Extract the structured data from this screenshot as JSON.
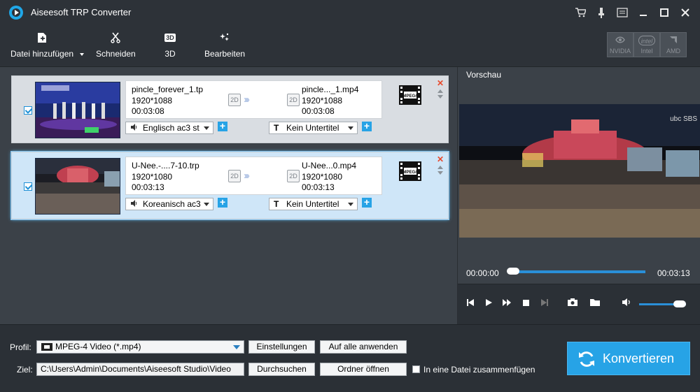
{
  "app": {
    "title": "Aiseesoft TRP Converter"
  },
  "toolbar": {
    "add_file": "Datei hinzufügen",
    "cut": "Schneiden",
    "three_d": "3D",
    "edit": "Bearbeiten",
    "hw_nvidia": "NVIDIA",
    "hw_intel": "Intel",
    "hw_amd": "AMD",
    "hw_intel_logo": "intel",
    "three_d_icon_text": "3D"
  },
  "files": [
    {
      "src_name": "pincle_forever_1.tp",
      "src_res": "1920*1088",
      "src_dur": "00:03:08",
      "dst_name": "pincle..._1.mp4",
      "dst_res": "1920*1088",
      "dst_dur": "00:03:08",
      "badge_src": "2D",
      "badge_dst": "2D",
      "audio": "Englisch ac3 st",
      "subtitle": "Kein Untertitel",
      "format_icon_label": "MPEG4"
    },
    {
      "src_name": "U-Nee.-....7-10.trp",
      "src_res": "1920*1080",
      "src_dur": "00:03:13",
      "dst_name": "U-Nee...0.mp4",
      "dst_res": "1920*1080",
      "dst_dur": "00:03:13",
      "badge_src": "2D",
      "badge_dst": "2D",
      "audio": "Koreanisch ac3",
      "subtitle": "Kein Untertitel",
      "format_icon_label": "MPEG4"
    }
  ],
  "preview": {
    "title": "Vorschau",
    "current_time": "00:00:00",
    "total_time": "00:03:13",
    "progress": 0,
    "volume": 0.8,
    "watermark": "ubc SBS"
  },
  "bottom": {
    "profile_label": "Profil:",
    "profile_value": "MPEG-4 Video (*.mp4)",
    "settings_btn": "Einstellungen",
    "apply_all_btn": "Auf alle anwenden",
    "dest_label": "Ziel:",
    "dest_value": "C:\\Users\\Admin\\Documents\\Aiseesoft Studio\\Video",
    "browse_btn": "Durchsuchen",
    "open_folder_btn": "Ordner öffnen",
    "merge_label": "In eine Datei zusammenfügen",
    "convert_btn": "Konvertieren"
  },
  "colors": {
    "accent": "#27a3e6",
    "bg_dark": "#2b3036",
    "panel": "#3b4148"
  }
}
